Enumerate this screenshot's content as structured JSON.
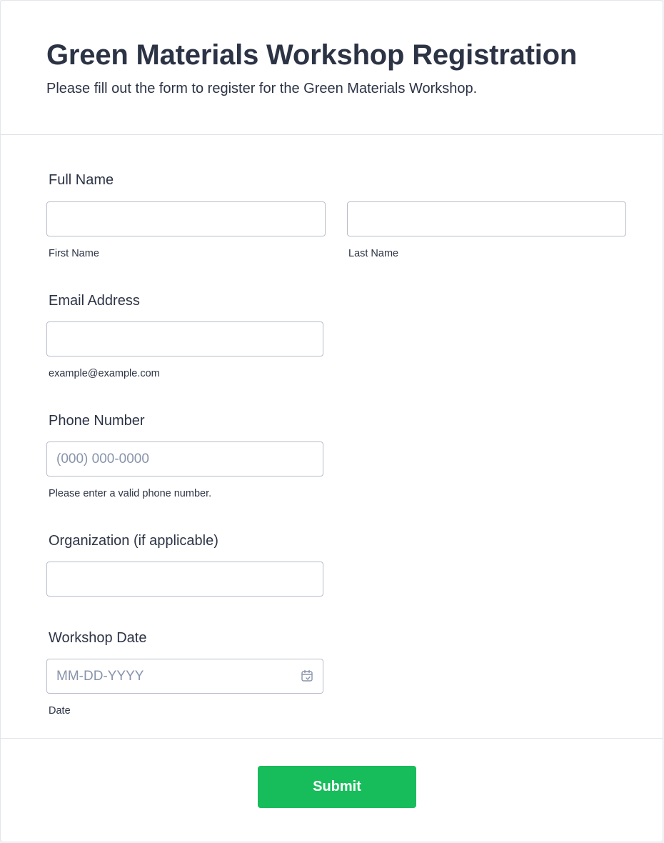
{
  "header": {
    "title": "Green Materials Workshop Registration",
    "subtitle": "Please fill out the form to register for the Green Materials Workshop."
  },
  "form": {
    "full_name": {
      "label": "Full Name",
      "first": {
        "value": "",
        "sublabel": "First Name"
      },
      "last": {
        "value": "",
        "sublabel": "Last Name"
      }
    },
    "email": {
      "label": "Email Address",
      "value": "",
      "sublabel": "example@example.com"
    },
    "phone": {
      "label": "Phone Number",
      "value": "",
      "placeholder": "(000) 000-0000",
      "sublabel": "Please enter a valid phone number."
    },
    "organization": {
      "label": "Organization (if applicable)",
      "value": ""
    },
    "workshop_date": {
      "label": "Workshop Date",
      "value": "",
      "placeholder": "MM-DD-YYYY",
      "sublabel": "Date",
      "icon": "calendar-icon"
    }
  },
  "footer": {
    "submit_label": "Submit"
  },
  "colors": {
    "accent": "#18bd5b",
    "text": "#2c3345",
    "placeholder": "#8894ab",
    "border": "#b8bdc9"
  }
}
